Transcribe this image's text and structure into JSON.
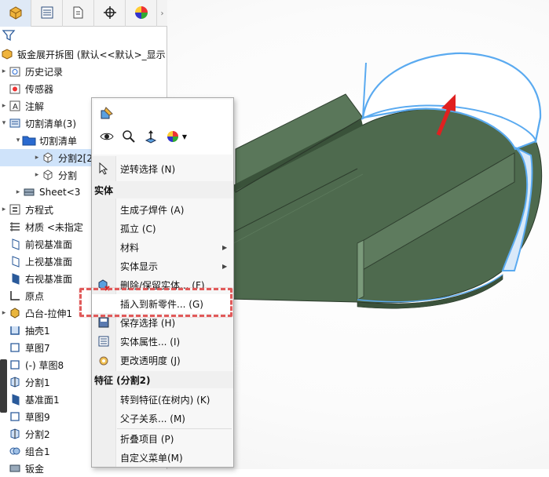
{
  "tabs": [
    {
      "name": "feature-manager-tab",
      "icon": "feature-tree-icon"
    },
    {
      "name": "property-manager-tab",
      "icon": "property-list-icon"
    },
    {
      "name": "configuration-manager-tab",
      "icon": "configuration-icon"
    },
    {
      "name": "dimxpert-manager-tab",
      "icon": "crosshair-icon"
    },
    {
      "name": "display-manager-tab",
      "icon": "color-pie-icon"
    }
  ],
  "tree": {
    "root_label": "钣金展开拆图 (默认<<默认>_显示",
    "items": [
      {
        "label": "历史记录",
        "icon": "history-icon"
      },
      {
        "label": "传感器",
        "icon": "sensor-icon"
      },
      {
        "label": "注解",
        "icon": "annotation-icon"
      },
      {
        "label": "切割清单(3)",
        "icon": "cutlist-icon"
      },
      {
        "label": "切割清单",
        "icon": "folder-icon"
      },
      {
        "label": "分割2[2]",
        "icon": "body-icon"
      },
      {
        "label": "分割",
        "icon": "body-icon"
      },
      {
        "label": "Sheet<3",
        "icon": "sheetmetal-icon"
      },
      {
        "label": "方程式",
        "icon": "equation-icon"
      },
      {
        "label": "材质 <未指定",
        "icon": "material-icon"
      },
      {
        "label": "前视基准面",
        "icon": "plane-icon"
      },
      {
        "label": "上视基准面",
        "icon": "plane-icon"
      },
      {
        "label": "右视基准面",
        "icon": "plane-icon"
      },
      {
        "label": "原点",
        "icon": "origin-icon"
      },
      {
        "label": "凸台-拉伸1",
        "icon": "extrude-icon"
      },
      {
        "label": "抽壳1",
        "icon": "shell-icon"
      },
      {
        "label": "草图7",
        "icon": "sketch-icon"
      },
      {
        "label": "(-) 草图8",
        "icon": "sketch-icon"
      },
      {
        "label": "分割1",
        "icon": "split-icon"
      },
      {
        "label": "基准面1",
        "icon": "plane-icon"
      },
      {
        "label": "草图9",
        "icon": "sketch-icon"
      },
      {
        "label": "分割2",
        "icon": "split-icon"
      },
      {
        "label": "组合1",
        "icon": "combine-icon"
      },
      {
        "label": "钣金",
        "icon": "sheetmetal-icon"
      }
    ]
  },
  "menu": {
    "items_top": [
      {
        "label": "逆转选择 (N)",
        "icon": "cursor-arrow-icon"
      }
    ],
    "section_body": "实体",
    "items_body": [
      {
        "label": "生成子焊件 (A)",
        "icon": "",
        "submenu": false
      },
      {
        "label": "孤立 (C)",
        "icon": "",
        "submenu": false
      },
      {
        "label": "材料",
        "icon": "",
        "submenu": true
      },
      {
        "label": "实体显示",
        "icon": "",
        "submenu": true
      },
      {
        "label": "删除/保留实体... (F)",
        "icon": "delete-body-icon",
        "submenu": false
      },
      {
        "label": "插入到新零件... (G)",
        "icon": "",
        "submenu": false
      },
      {
        "label": "保存选择 (H)",
        "icon": "save-selection-icon",
        "submenu": false
      },
      {
        "label": "实体属性... (I)",
        "icon": "properties-icon",
        "submenu": false
      },
      {
        "label": "更改透明度 (J)",
        "icon": "transparency-icon",
        "submenu": false
      }
    ],
    "section_feature": "特征 (分割2)",
    "items_feature": [
      {
        "label": "转到特征(在树内) (K)",
        "icon": ""
      },
      {
        "label": "父子关系... (M)",
        "icon": ""
      }
    ],
    "items_bottom": [
      {
        "label": "折叠项目 (P)",
        "icon": ""
      },
      {
        "label": "自定义菜单(M)",
        "icon": ""
      }
    ]
  },
  "colors": {
    "part_face": "#4e6a4e",
    "selection_edge": "#5aaaf0",
    "highlight_dash": "#e05a5a",
    "arrow": "#e02020"
  }
}
